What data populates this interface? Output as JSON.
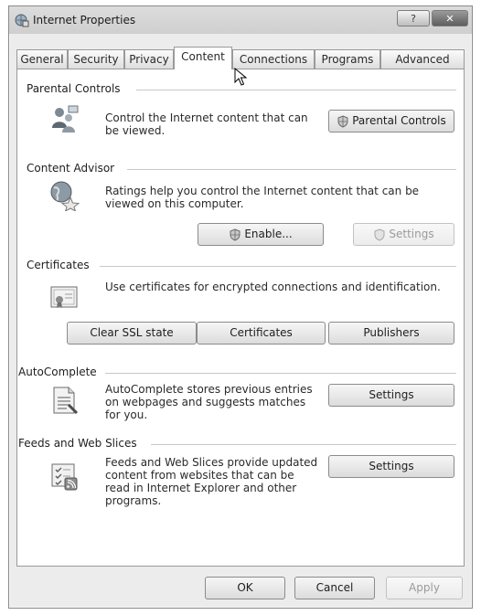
{
  "window": {
    "title": "Internet Properties",
    "help_label": "?",
    "close_label": "✕"
  },
  "tabs": [
    {
      "label": "General"
    },
    {
      "label": "Security"
    },
    {
      "label": "Privacy"
    },
    {
      "label": "Content"
    },
    {
      "label": "Connections"
    },
    {
      "label": "Programs"
    },
    {
      "label": "Advanced"
    }
  ],
  "active_tab": "Content",
  "parental": {
    "title": "Parental Controls",
    "desc1": "Control the Internet content that can",
    "desc2": "be viewed.",
    "button": "Parental Controls"
  },
  "advisor": {
    "title": "Content Advisor",
    "desc1": "Ratings help you control the Internet content that can be",
    "desc2": "viewed on this computer.",
    "enable_button": "Enable...",
    "settings_button": "Settings"
  },
  "certificates": {
    "title": "Certificates",
    "desc": "Use certificates for encrypted connections and identification.",
    "clear_button": "Clear SSL state",
    "certs_button": "Certificates",
    "publishers_button": "Publishers"
  },
  "autocomplete": {
    "title": "AutoComplete",
    "desc1": "AutoComplete stores previous entries",
    "desc2": "on webpages and suggests matches",
    "desc3": "for you.",
    "settings_button": "Settings"
  },
  "feeds": {
    "title": "Feeds and Web Slices",
    "desc1": "Feeds and Web Slices provide updated",
    "desc2": "content from websites that can be",
    "desc3": "read in Internet Explorer and other",
    "desc4": "programs.",
    "settings_button": "Settings"
  },
  "footer": {
    "ok": "OK",
    "cancel": "Cancel",
    "apply": "Apply"
  }
}
